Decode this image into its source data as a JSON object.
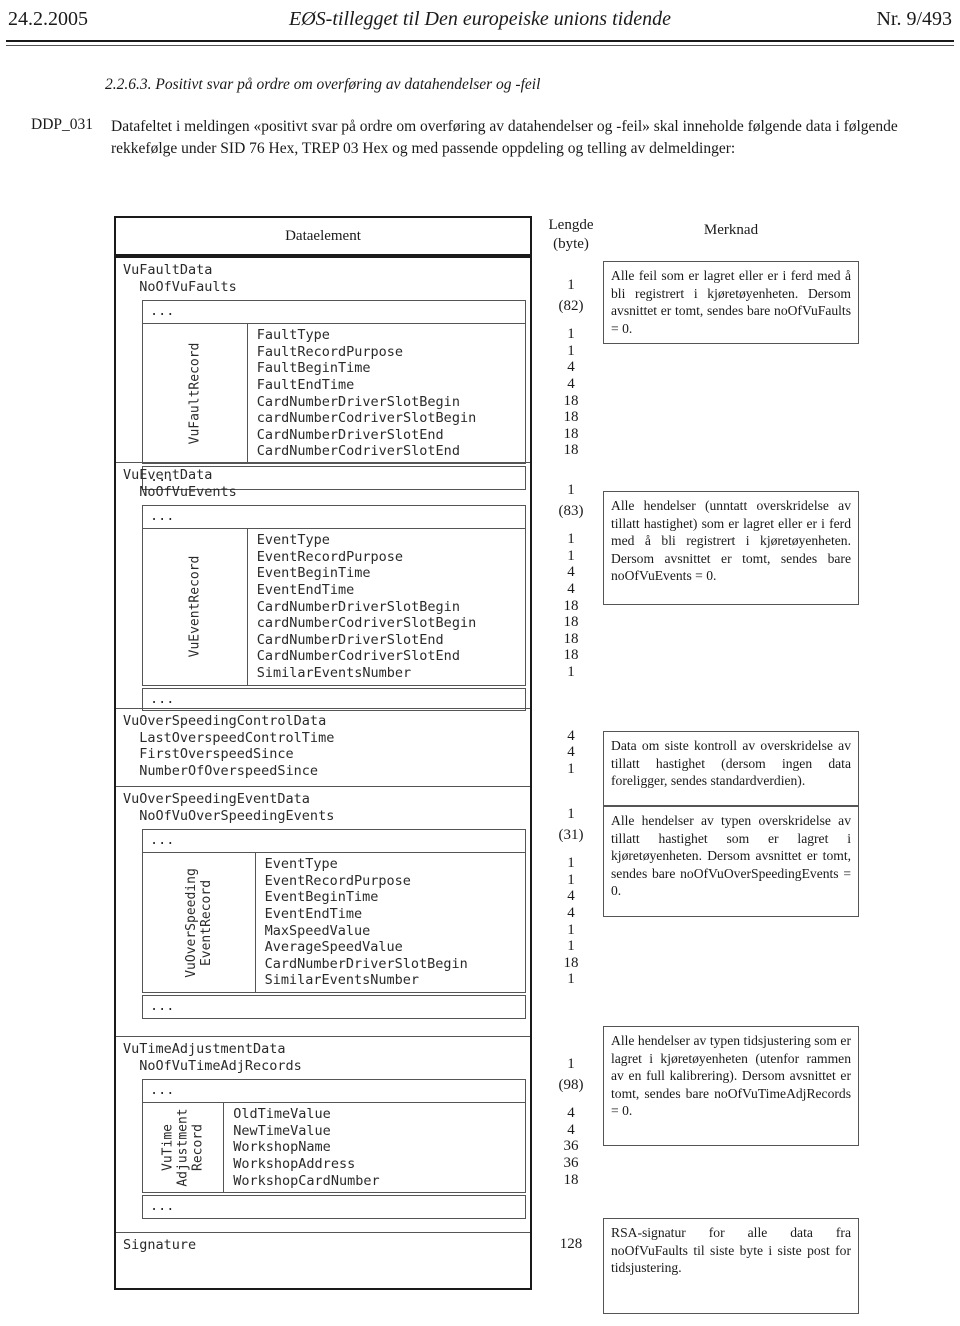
{
  "runhead": {
    "date": "24.2.2005",
    "title": "EØS-tillegget til Den europeiske unions tidende",
    "number": "Nr. 9/493"
  },
  "section": {
    "number": "2.2.6.3.",
    "heading": "Positivt svar på ordre om overføring av datahendelser og -feil",
    "ref_id": "DDP_031",
    "paragraph": "Datafeltet i meldingen «positivt svar på ordre om overføring av datahendelser og -feil» skal inneholde følgende data i følgende rekkefølge under SID 76 Hex, TREP 03 Hex og med passende oppdeling og telling av delmeldinger:"
  },
  "table": {
    "headers": {
      "data": "Dataelement",
      "length_l1": "Lengde",
      "length_l2": "(byte)",
      "note": "Merknad"
    },
    "ellipsis": "...",
    "groups": [
      {
        "id": "vufaultdata",
        "title": "VuFaultData",
        "count_field": "NoOfVuFaults",
        "count_len": "1",
        "inner_len": "(82)",
        "record_label": "VuFaultRecord",
        "record_label_lines": [
          "VuFaultRecord"
        ],
        "fields": [
          {
            "name": "FaultType",
            "len": "1"
          },
          {
            "name": "FaultRecordPurpose",
            "len": "1"
          },
          {
            "name": "FaultBeginTime",
            "len": "4"
          },
          {
            "name": "FaultEndTime",
            "len": "4"
          },
          {
            "name": "CardNumberDriverSlotBegin",
            "len": "18"
          },
          {
            "name": "cardNumberCodriverSlotBegin",
            "len": "18"
          },
          {
            "name": "CardNumberDriverSlotEnd",
            "len": "18"
          },
          {
            "name": "CardNumberCodriverSlotEnd",
            "len": "18"
          }
        ],
        "note": "Alle feil som er lagret eller er i ferd med å bli registrert i kjøretøyenheten. Dersom avsnittet er tomt, sendes bare noOfVuFaults = 0."
      },
      {
        "id": "vueventdata",
        "title": "VuEventData",
        "count_field": "NoOfVuEvents",
        "count_len": "1",
        "inner_len": "(83)",
        "record_label": "VuEventRecord",
        "record_label_lines": [
          "VuEventRecord"
        ],
        "fields": [
          {
            "name": "EventType",
            "len": "1"
          },
          {
            "name": "EventRecordPurpose",
            "len": "1"
          },
          {
            "name": "EventBeginTime",
            "len": "4"
          },
          {
            "name": "EventEndTime",
            "len": "4"
          },
          {
            "name": "CardNumberDriverSlotBegin",
            "len": "18"
          },
          {
            "name": "cardNumberCodriverSlotBegin",
            "len": "18"
          },
          {
            "name": "CardNumberDriverSlotEnd",
            "len": "18"
          },
          {
            "name": "CardNumberCodriverSlotEnd",
            "len": "18"
          },
          {
            "name": "SimilarEventsNumber",
            "len": "1"
          }
        ],
        "note": "Alle hendelser (unntatt overskridelse av tillatt hastighet) som er lagret eller er i ferd med å bli registrert i kjøretøyenheten. Dersom avsnittet er tomt, sendes bare noOfVuEvents = 0."
      },
      {
        "id": "vuoverspeedingcontroldata",
        "title": "VuOverSpeedingControlData",
        "fields": [
          {
            "name": "LastOverspeedControlTime",
            "len": "4"
          },
          {
            "name": "FirstOverspeedSince",
            "len": "4"
          },
          {
            "name": "NumberOfOverspeedSince",
            "len": "1"
          }
        ],
        "note": "Data om siste kontroll av overskridelse av tillatt hastighet (dersom ingen data foreligger, sendes standardverdien)."
      },
      {
        "id": "vuoverspeedingeventdata",
        "title": "VuOverSpeedingEventData",
        "count_field": "NoOfVuOverSpeedingEvents",
        "count_len": "1",
        "inner_len": "(31)",
        "record_label": "VuOverSpeeding EventRecord",
        "record_label_lines": [
          "VuOverSpeeding",
          "EventRecord"
        ],
        "fields": [
          {
            "name": "EventType",
            "len": "1"
          },
          {
            "name": "EventRecordPurpose",
            "len": "1"
          },
          {
            "name": "EventBeginTime",
            "len": "4"
          },
          {
            "name": "EventEndTime",
            "len": "4"
          },
          {
            "name": "MaxSpeedValue",
            "len": "1"
          },
          {
            "name": "AverageSpeedValue",
            "len": "1"
          },
          {
            "name": "CardNumberDriverSlotBegin",
            "len": "18"
          },
          {
            "name": "SimilarEventsNumber",
            "len": "1"
          }
        ],
        "note": "Alle hendelser av typen overskridelse av tillatt hastighet som er lagret i kjøretøyenheten. Dersom avsnittet er tomt, sendes bare noOfVuOverSpeedingEvents = 0."
      },
      {
        "id": "vutimeadjustmentdata",
        "title": "VuTimeAdjustmentData",
        "count_field": "NoOfVuTimeAdjRecords",
        "count_len": "1",
        "inner_len": "(98)",
        "record_label": "VuTime Adjustment Record",
        "record_label_lines": [
          "VuTime",
          "Adjustment",
          "Record"
        ],
        "fields": [
          {
            "name": "OldTimeValue",
            "len": "4"
          },
          {
            "name": "NewTimeValue",
            "len": "4"
          },
          {
            "name": "WorkshopName",
            "len": "36"
          },
          {
            "name": "WorkshopAddress",
            "len": "36"
          },
          {
            "name": "WorkshopCardNumber",
            "len": "18"
          }
        ],
        "note": "Alle hendelser av typen tidsjustering som er lagret i kjøretøyenheten (utenfor rammen av en full kalibrering). Dersom avsnittet er tomt, sendes bare noOfVuTimeAdjRecords = 0."
      },
      {
        "id": "signature",
        "title": "Signature",
        "count_len": "128",
        "note": "RSA-signatur for alle data fra noOfVuFaults til siste byte i siste post for tidsjustering."
      }
    ]
  }
}
